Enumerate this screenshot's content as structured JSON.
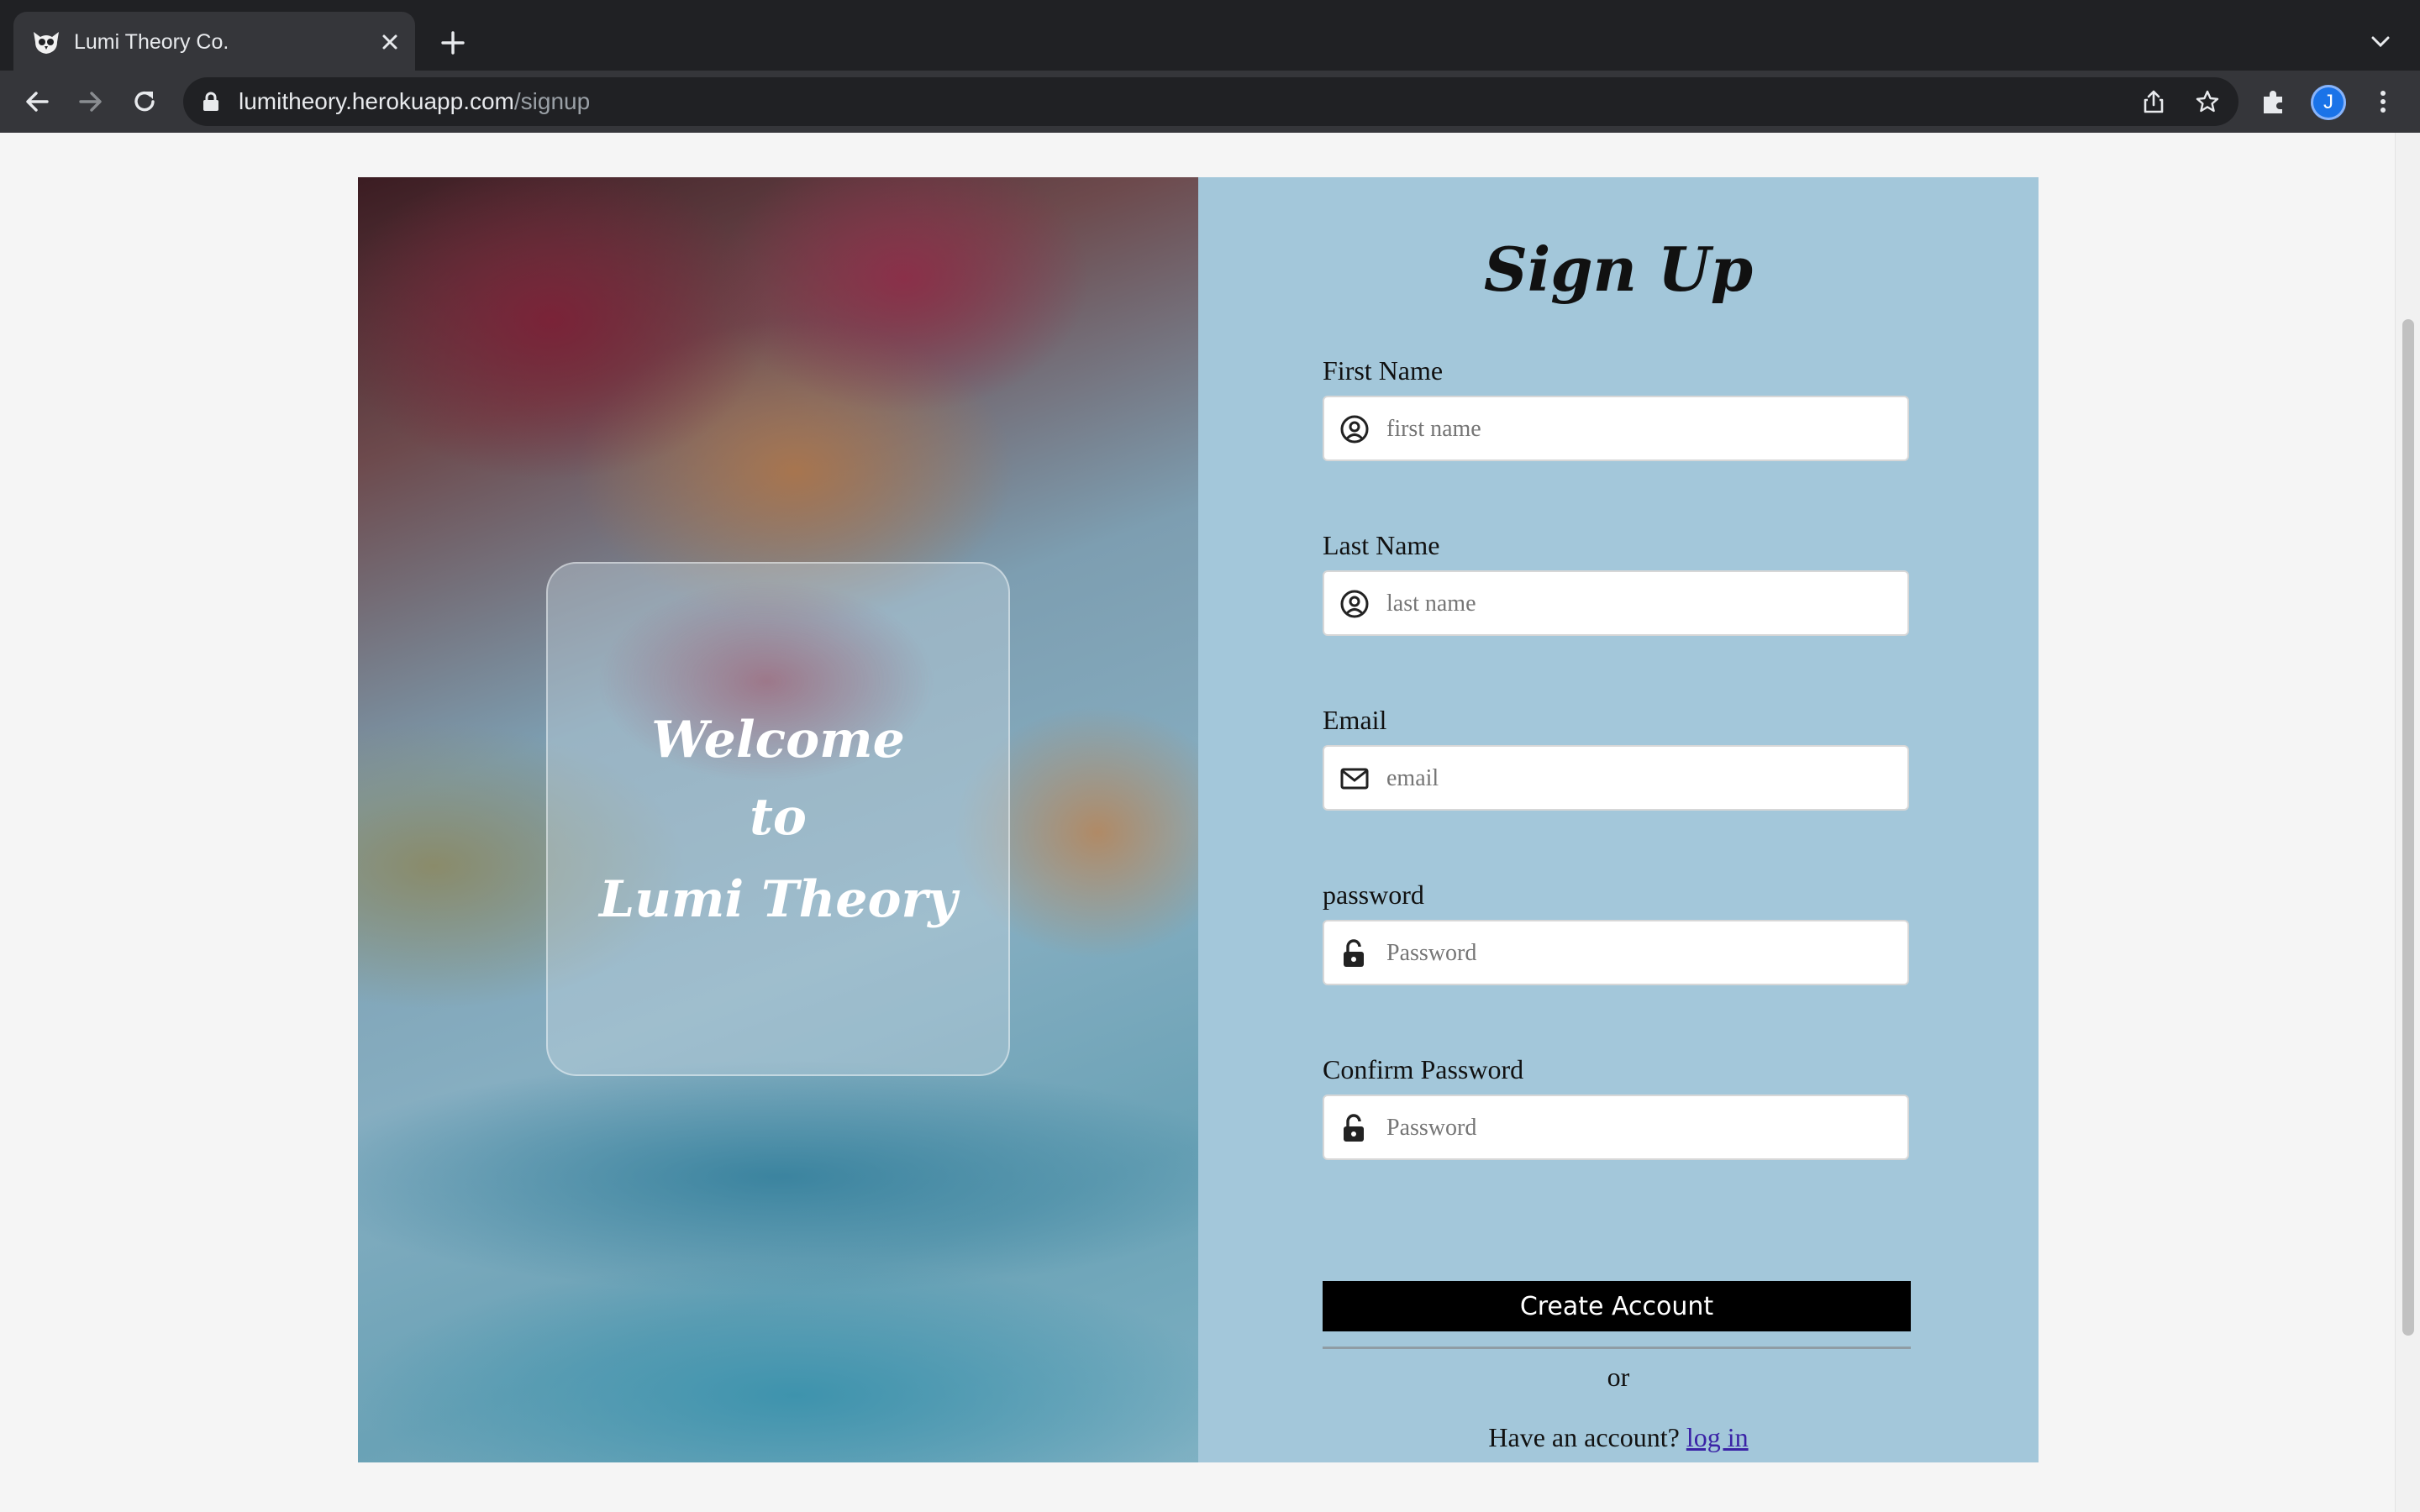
{
  "browser": {
    "tab_title": "Lumi Theory Co.",
    "url_host": "lumitheory.herokuapp.com",
    "url_path": "/signup",
    "profile_initial": "J"
  },
  "hero": {
    "line1": "Welcome",
    "line2": "to",
    "line3": "Lumi Theory"
  },
  "form": {
    "heading": "Sign Up",
    "fields": [
      {
        "label": "First Name",
        "placeholder": "first name",
        "icon": "user-circle-icon"
      },
      {
        "label": "Last Name",
        "placeholder": "last name",
        "icon": "user-circle-icon"
      },
      {
        "label": "Email",
        "placeholder": "email",
        "icon": "envelope-icon"
      },
      {
        "label": "password",
        "placeholder": "Password",
        "icon": "unlock-icon"
      },
      {
        "label": "Confirm Password",
        "placeholder": "Password",
        "icon": "unlock-icon"
      }
    ],
    "submit_label": "Create Account",
    "or_text": "or",
    "have_account_text": "Have an account? ",
    "login_link": "log in"
  },
  "colors": {
    "form_panel": "#a3c7da",
    "button": "#000000",
    "link": "#3a22a6"
  }
}
